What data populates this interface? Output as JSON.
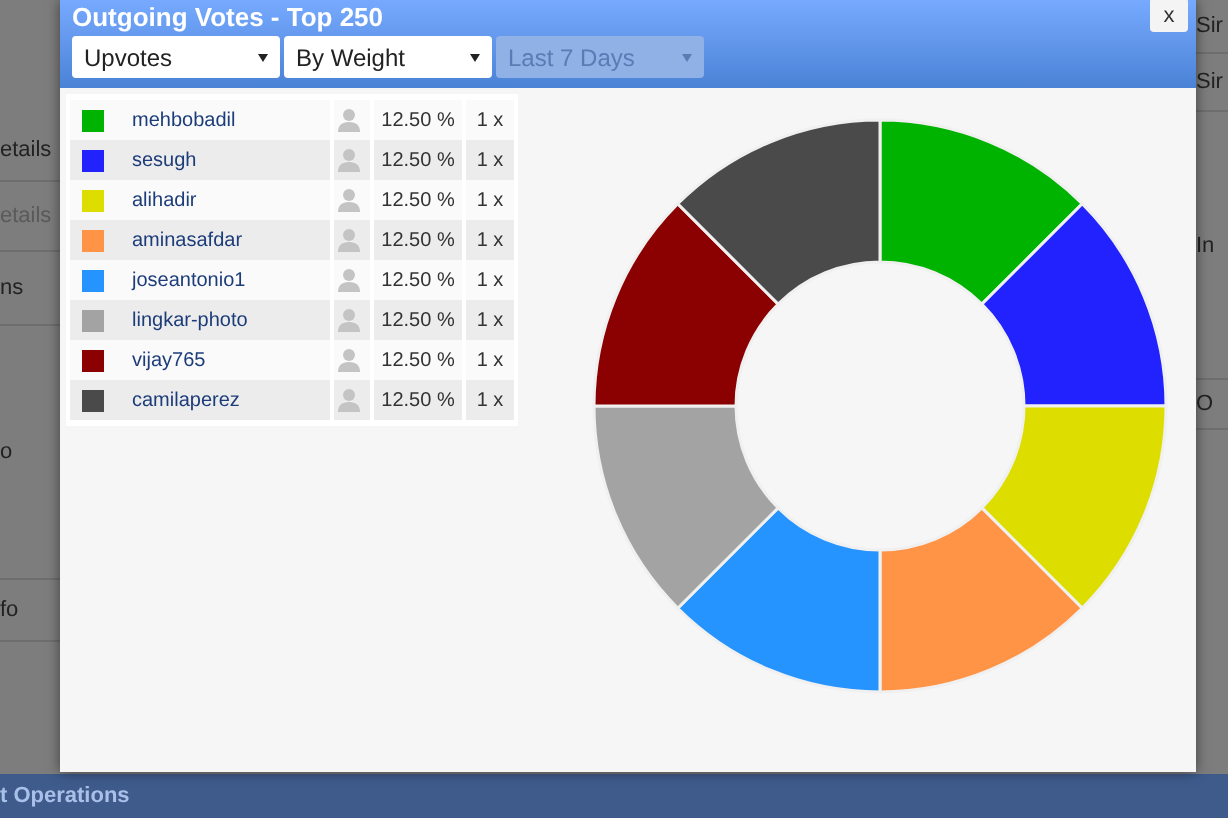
{
  "background": {
    "left_texts": [
      {
        "text": "etails",
        "disabled": false
      },
      {
        "text": "etails",
        "disabled": true
      },
      {
        "text": "ns",
        "disabled": false
      },
      {
        "text": "o",
        "disabled": false
      },
      {
        "text": "fo",
        "disabled": false
      }
    ],
    "right_texts": [
      "Sir",
      "Sir",
      "In",
      "O"
    ],
    "footer": "t Operations"
  },
  "dialog": {
    "title": "Outgoing Votes - Top 250",
    "close": "x",
    "filters": [
      {
        "label": "Upvotes",
        "disabled": false
      },
      {
        "label": "By Weight",
        "disabled": false
      },
      {
        "label": "Last 7 Days",
        "disabled": true
      }
    ],
    "rows": [
      {
        "name": "mehbobadil",
        "color": "#00b300",
        "share": "12.50 %",
        "count": "1 x"
      },
      {
        "name": "sesugh",
        "color": "#2222ff",
        "share": "12.50 %",
        "count": "1 x"
      },
      {
        "name": "alihadir",
        "color": "#dddd00",
        "share": "12.50 %",
        "count": "1 x"
      },
      {
        "name": "aminasafdar",
        "color": "#ff9447",
        "share": "12.50 %",
        "count": "1 x"
      },
      {
        "name": "joseantonio1",
        "color": "#2694ff",
        "share": "12.50 %",
        "count": "1 x"
      },
      {
        "name": "lingkar-photo",
        "color": "#a3a3a3",
        "share": "12.50 %",
        "count": "1 x"
      },
      {
        "name": "vijay765",
        "color": "#8b0000",
        "share": "12.50 %",
        "count": "1 x"
      },
      {
        "name": "camilaperez",
        "color": "#4a4a4a",
        "share": "12.50 %",
        "count": "1 x"
      }
    ],
    "chart_data": {
      "type": "donut",
      "series": [
        {
          "colors": [
            "#00b300",
            "#2222ff",
            "#dddd00",
            "#ff9447",
            "#2694ff",
            "#a3a3a3",
            "#8b0000",
            "#4a4a4a"
          ],
          "values": [
            12.5,
            12.5,
            12.5,
            12.5,
            12.5,
            12.5,
            12.5,
            12.5
          ]
        }
      ]
    }
  }
}
